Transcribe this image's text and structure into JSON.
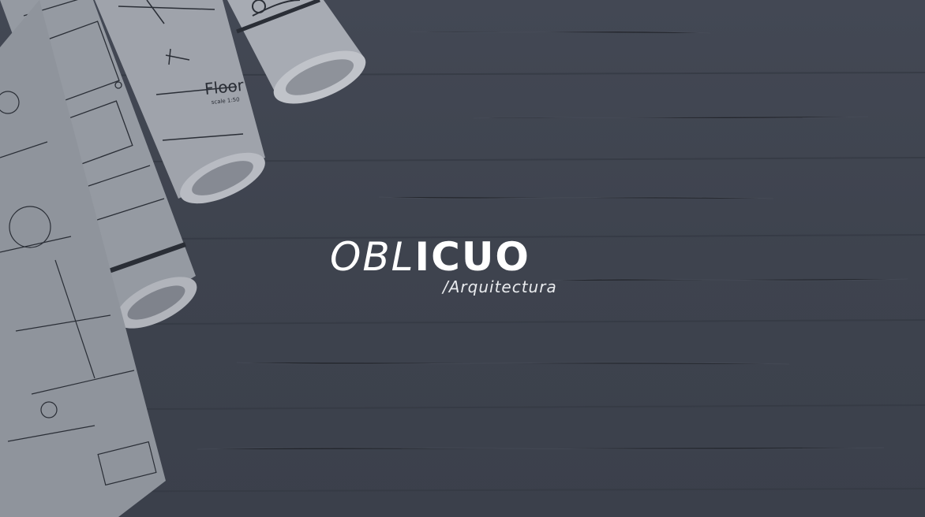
{
  "brand": {
    "name_light": "OBL",
    "name_bold": "ICUO",
    "tagline": "/Arquitectura"
  },
  "background": {
    "plan_label": "Floor",
    "plan_sublabel": "scale 1:50"
  },
  "colors": {
    "background": "#3f4450",
    "paper": "#9fa3ab",
    "ink": "#2a2e36",
    "logo": "#ffffff"
  }
}
